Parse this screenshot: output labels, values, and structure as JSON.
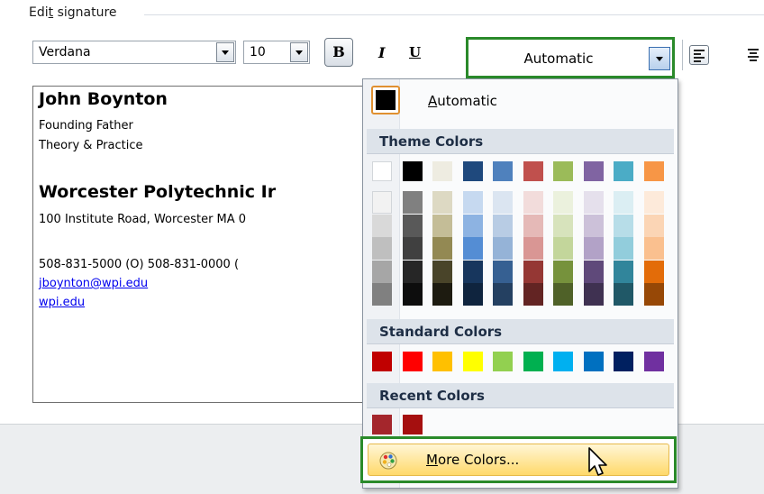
{
  "section": {
    "title": "Edit signature",
    "mnemonic": "t"
  },
  "toolbar": {
    "font": "Verdana",
    "size": "10",
    "bold_label": "B",
    "italic_label": "I",
    "underline_label": "U",
    "color_value": "Automatic"
  },
  "editor": {
    "name": "John Boynton",
    "line2": "Founding Father",
    "line3": "Theory & Practice",
    "org": "Worcester Polytechnic Ir",
    "address": "100 Institute Road, Worcester MA 0",
    "phones": "508-831-5000 (O)  508-831-0000 (",
    "email": "jboynton@wpi.edu",
    "web": "wpi.edu"
  },
  "picker": {
    "automatic_label": "Automatic",
    "theme_header": "Theme Colors",
    "standard_header": "Standard Colors",
    "recent_header": "Recent Colors",
    "more_label": "More Colors...",
    "theme_top": [
      "#ffffff",
      "#000000",
      "#eeece1",
      "#1f497d",
      "#4f81bd",
      "#c0504d",
      "#9bbb59",
      "#8064a2",
      "#4bacc6",
      "#f79646"
    ],
    "theme_shades": [
      [
        "#f2f2f2",
        "#d9d9d9",
        "#bfbfbf",
        "#a6a6a6",
        "#808080"
      ],
      [
        "#808080",
        "#595959",
        "#404040",
        "#262626",
        "#0d0d0d"
      ],
      [
        "#ddd9c3",
        "#c4bd97",
        "#938953",
        "#494429",
        "#1d1b10"
      ],
      [
        "#c6d9f0",
        "#8db3e2",
        "#548dd4",
        "#17365d",
        "#0f243e"
      ],
      [
        "#dbe5f1",
        "#b8cce4",
        "#95b3d7",
        "#366092",
        "#244061"
      ],
      [
        "#f2dcdb",
        "#e5b9b7",
        "#d99694",
        "#953734",
        "#632423"
      ],
      [
        "#ebf1dd",
        "#d7e3bc",
        "#c3d69b",
        "#76923c",
        "#4f6128"
      ],
      [
        "#e5e0ec",
        "#ccc1d9",
        "#b2a2c7",
        "#5f497a",
        "#3f3151"
      ],
      [
        "#dbeef3",
        "#b7dde8",
        "#92cddc",
        "#31859b",
        "#205867"
      ],
      [
        "#fdeada",
        "#fbd5b5",
        "#fac08f",
        "#e36c09",
        "#974806"
      ]
    ],
    "standard": [
      "#c00000",
      "#ff0000",
      "#ffc000",
      "#ffff00",
      "#92d050",
      "#00b050",
      "#00b0f0",
      "#0070c0",
      "#002060",
      "#7030a0"
    ],
    "recent": [
      "#a4262c",
      "#a50f0f"
    ]
  }
}
